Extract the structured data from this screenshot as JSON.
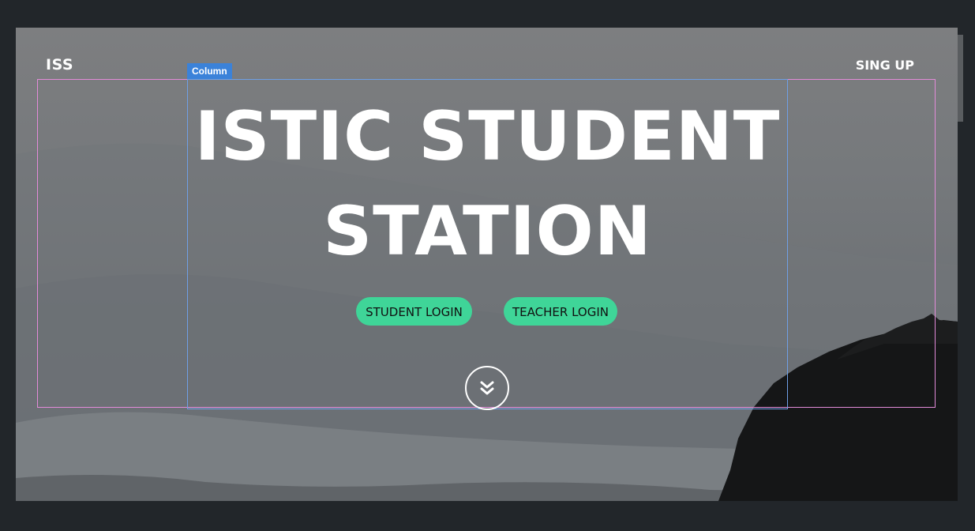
{
  "nav": {
    "logo": "ISS",
    "signup_label": "SING UP"
  },
  "editor": {
    "column_tag": "Column"
  },
  "hero": {
    "title_line1": "ISTIC STUDENT",
    "title_line2": "STATION",
    "student_login_label": "STUDENT LOGIN",
    "teacher_login_label": "TEACHER LOGIN",
    "scroll_icon": "double-chevron-down-icon"
  },
  "colors": {
    "accent": "#3fd598",
    "column_outline": "#6f9fe6",
    "row_outline": "#e38bd9",
    "column_tag": "#3b82d9"
  }
}
